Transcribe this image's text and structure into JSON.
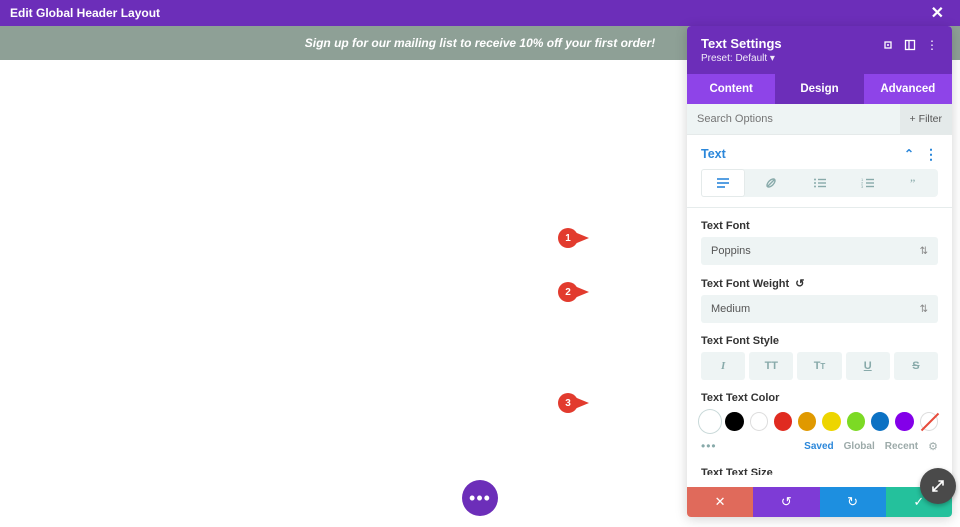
{
  "topbar": {
    "title": "Edit Global Header Layout"
  },
  "banner": {
    "text": "Sign up for our mailing list to receive  10% off your first order!"
  },
  "panel": {
    "title": "Text Settings",
    "preset": "Preset: Default ▾",
    "tabs": {
      "content": "Content",
      "design": "Design",
      "advanced": "Advanced"
    },
    "search_placeholder": "Search Options",
    "filter_label": "Filter",
    "section_title": "Text",
    "font_label": "Text Font",
    "font_value": "Poppins",
    "weight_label": "Text Font Weight",
    "weight_value": "Medium",
    "style_label": "Text Font Style",
    "color_label": "Text Text Color",
    "size_label_cut": "Text Text Size",
    "color_filters": {
      "saved": "Saved",
      "global": "Global",
      "recent": "Recent"
    },
    "swatches": [
      {
        "name": "white-selected",
        "color": "#ffffff",
        "selected": true,
        "outline": true
      },
      {
        "name": "black",
        "color": "#000000"
      },
      {
        "name": "white",
        "color": "#ffffff",
        "outline": true
      },
      {
        "name": "red",
        "color": "#e02b20"
      },
      {
        "name": "orange",
        "color": "#e09900"
      },
      {
        "name": "yellow",
        "color": "#edd500"
      },
      {
        "name": "green",
        "color": "#7cda24"
      },
      {
        "name": "blue",
        "color": "#0c71c3"
      },
      {
        "name": "purple",
        "color": "#8300e9"
      },
      {
        "name": "none",
        "color": "#ffffff",
        "outline": true,
        "none": true
      }
    ]
  },
  "markers": {
    "m1": "1",
    "m2": "2",
    "m3": "3"
  }
}
